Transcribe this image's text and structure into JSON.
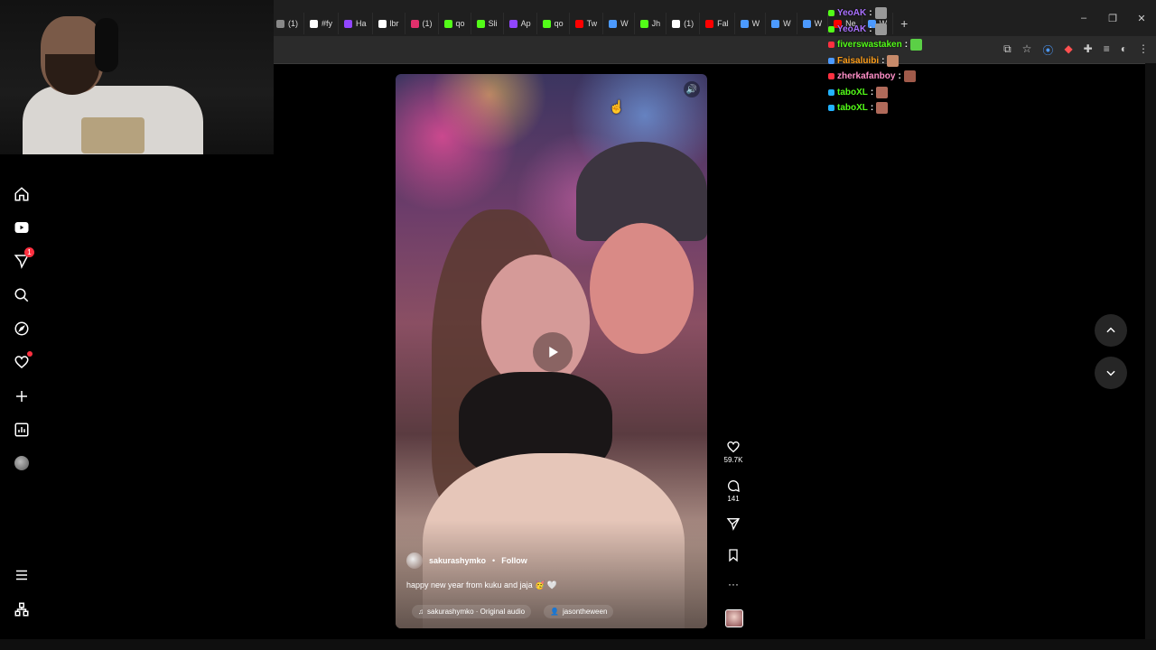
{
  "browser": {
    "tabs": [
      {
        "label": "(1)",
        "color": "#888888"
      },
      {
        "label": "#fy",
        "color": "#ffffff"
      },
      {
        "label": "Ha",
        "color": "#9146ff"
      },
      {
        "label": "lbr",
        "color": "#ffffff"
      },
      {
        "label": "(1)",
        "color": "#e1306c"
      },
      {
        "label": "qo",
        "color": "#53fc18"
      },
      {
        "label": "Sli",
        "color": "#53fc18"
      },
      {
        "label": "Ap",
        "color": "#9146ff"
      },
      {
        "label": "qo",
        "color": "#53fc18"
      },
      {
        "label": "Tw",
        "color": "#ff0000"
      },
      {
        "label": "W",
        "color": "#4c9aff"
      },
      {
        "label": "Jh",
        "color": "#53fc18"
      },
      {
        "label": "(1)",
        "color": "#ffffff"
      },
      {
        "label": "Fal",
        "color": "#ff0000"
      },
      {
        "label": "W",
        "color": "#4c9aff"
      },
      {
        "label": "W",
        "color": "#4c9aff"
      },
      {
        "label": "W",
        "color": "#4c9aff"
      },
      {
        "label": "Ne",
        "color": "#ff0000"
      },
      {
        "label": "W",
        "color": "#4c9aff"
      }
    ],
    "new_tab": "+",
    "window_controls": {
      "minimize": "–",
      "restore": "❐",
      "close": "✕"
    }
  },
  "chat": [
    {
      "user": "YeoAK",
      "color": "#a970ff",
      "badge": "#53fc18",
      "emote": "#999999"
    },
    {
      "user": "YeoAK",
      "color": "#a970ff",
      "badge": "#53fc18",
      "emote": "#999999"
    },
    {
      "user": "fiverswastaken",
      "color": "#53fc18",
      "badge": "#ff3040",
      "emote": "#5bd046"
    },
    {
      "user": "Faisaluibi",
      "color": "#ff9f1a",
      "badge": "#4c9aff",
      "emote": "#c78a6a"
    },
    {
      "user": "zherkafanboy",
      "color": "#ff8fc8",
      "badge": "#ff3040",
      "emote": "#a05a4a"
    },
    {
      "user": "taboXL",
      "color": "#53fc18",
      "badge": "#22b2ff",
      "emote": "#b06a5a"
    },
    {
      "user": "taboXL",
      "color": "#53fc18",
      "badge": "#22b2ff",
      "emote": "#b06a5a"
    }
  ],
  "chat_colon": ":",
  "sidebar": {
    "notifications_badge": "1",
    "items": [
      "home-icon",
      "reels-icon",
      "messages-icon",
      "search-icon",
      "explore-icon",
      "notifications-icon",
      "create-icon",
      "dashboard-icon",
      "profile-icon"
    ],
    "bottom": [
      "menu-icon",
      "apps-icon"
    ]
  },
  "reel": {
    "username": "sakurashymko",
    "separator": "•",
    "follow_label": "Follow",
    "caption": "happy new year from kuku and jaja 🥳 🤍",
    "audio": "sakurashymko · Original audio",
    "tagged_user": "jasontheween",
    "mute_icon": "speaker-icon"
  },
  "actions": {
    "likes": "59.7K",
    "comments": "141",
    "more": "···"
  }
}
